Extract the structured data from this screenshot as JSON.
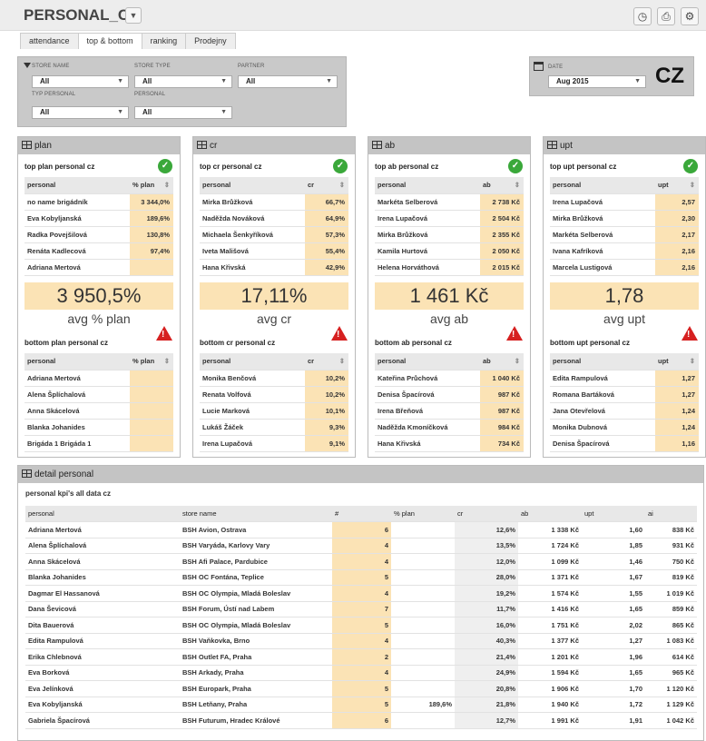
{
  "app": {
    "title": "PERSONAL_CZ",
    "country": "CZ"
  },
  "tabs": [
    {
      "label": "attendance"
    },
    {
      "label": "top & bottom"
    },
    {
      "label": "ranking"
    },
    {
      "label": "Prodejny"
    }
  ],
  "filters": {
    "store_name": {
      "label": "STORE NAME",
      "value": "All"
    },
    "store_type": {
      "label": "STORE TYPE",
      "value": "All"
    },
    "partner": {
      "label": "PARTNER",
      "value": "All"
    },
    "typ_personal": {
      "label": "TYP PERSONAL",
      "value": "All"
    },
    "personal": {
      "label": "PERSONAL",
      "value": "All"
    },
    "date": {
      "label": "DATE",
      "value": "Aug 2015"
    }
  },
  "panels": [
    {
      "title": "plan",
      "top_title": "top plan personal cz",
      "col": "% plan",
      "top": [
        [
          "no name brigádník",
          "3 344,0%"
        ],
        [
          "Eva Kobyljanská",
          "189,6%"
        ],
        [
          "Radka Povejšilová",
          "130,8%"
        ],
        [
          "Renáta Kadlecová",
          "97,4%"
        ],
        [
          "Adriana Mertová",
          ""
        ]
      ],
      "big": "3 950,5%",
      "big_label": "avg % plan",
      "bottom_title": "bottom plan personal cz",
      "bottom": [
        [
          "Adriana Mertová",
          ""
        ],
        [
          "Alena Šplíchalová",
          ""
        ],
        [
          "Anna Skácelová",
          ""
        ],
        [
          "Blanka Johanides",
          ""
        ],
        [
          "Brigáda 1 Brigáda 1",
          ""
        ]
      ]
    },
    {
      "title": "cr",
      "top_title": "top cr personal cz",
      "col": "cr",
      "top": [
        [
          "Mirka Brůžková",
          "66,7%"
        ],
        [
          "Naděžda Nováková",
          "64,9%"
        ],
        [
          "Michaela Šenkyříková",
          "57,3%"
        ],
        [
          "Iveta Mališová",
          "55,4%"
        ],
        [
          "Hana Křivská",
          "42,9%"
        ]
      ],
      "big": "17,11%",
      "big_label": "avg cr",
      "bottom_title": "bottom cr personal cz",
      "bottom": [
        [
          "Monika Benčová",
          "10,2%"
        ],
        [
          "Renata Volfová",
          "10,2%"
        ],
        [
          "Lucie Marková",
          "10,1%"
        ],
        [
          "Lukáš Žáček",
          "9,3%"
        ],
        [
          "Irena Lupačová",
          "9,1%"
        ]
      ]
    },
    {
      "title": "ab",
      "top_title": "top ab personal cz",
      "col": "ab",
      "top": [
        [
          "Markéta Selberová",
          "2 738 Kč"
        ],
        [
          "Irena Lupačová",
          "2 504 Kč"
        ],
        [
          "Mirka Brůžková",
          "2 355 Kč"
        ],
        [
          "Kamila Hurtová",
          "2 050 Kč"
        ],
        [
          "Helena Horváthová",
          "2 015 Kč"
        ]
      ],
      "big": "1 461 Kč",
      "big_label": "avg ab",
      "bottom_title": "bottom ab personal cz",
      "bottom": [
        [
          "Kateřina Průchová",
          "1 040 Kč"
        ],
        [
          "Denisa Špacírová",
          "987 Kč"
        ],
        [
          "Irena Břeňová",
          "987 Kč"
        ],
        [
          "Naděžda Kmoníčková",
          "984 Kč"
        ],
        [
          "Hana Křivská",
          "734 Kč"
        ]
      ]
    },
    {
      "title": "upt",
      "top_title": "top upt personal cz",
      "col": "upt",
      "top": [
        [
          "Irena Lupačová",
          "2,57"
        ],
        [
          "Mirka Brůžková",
          "2,30"
        ],
        [
          "Markéta Selberová",
          "2,17"
        ],
        [
          "Ivana Kafríková",
          "2,16"
        ],
        [
          "Marcela Lustigová",
          "2,16"
        ]
      ],
      "big": "1,78",
      "big_label": "avg upt",
      "bottom_title": "bottom upt personal cz",
      "bottom": [
        [
          "Edita Rampulová",
          "1,27"
        ],
        [
          "Romana Bartáková",
          "1,27"
        ],
        [
          "Jana Otevřelová",
          "1,24"
        ],
        [
          "Monika Dubnová",
          "1,24"
        ],
        [
          "Denisa Špacírová",
          "1,16"
        ]
      ]
    }
  ],
  "personal_header": "personal",
  "detail": {
    "title": "detail personal",
    "subtitle": "personal kpi's all data cz",
    "columns": [
      "personal",
      "store name",
      "#",
      "% plan",
      "cr",
      "ab",
      "upt",
      "ai"
    ],
    "rows": [
      [
        "Adriana Mertová",
        "BSH Avion, Ostrava",
        "6",
        "",
        "12,6%",
        "1 338 Kč",
        "1,60",
        "838 Kč"
      ],
      [
        "Alena Šplíchalová",
        "BSH Varyáda, Karlovy Vary",
        "4",
        "",
        "13,5%",
        "1 724 Kč",
        "1,85",
        "931 Kč"
      ],
      [
        "Anna Skácelová",
        "BSH Afi Palace, Pardubice",
        "4",
        "",
        "12,0%",
        "1 099 Kč",
        "1,46",
        "750 Kč"
      ],
      [
        "Blanka Johanides",
        "BSH OC Fontána, Teplice",
        "5",
        "",
        "28,0%",
        "1 371 Kč",
        "1,67",
        "819 Kč"
      ],
      [
        "Dagmar El Hassanová",
        "BSH OC Olympia, Mladá Boleslav",
        "4",
        "",
        "19,2%",
        "1 574 Kč",
        "1,55",
        "1 019 Kč"
      ],
      [
        "Dana Ševicová",
        "BSH Forum, Ústí nad Labem",
        "7",
        "",
        "11,7%",
        "1 416 Kč",
        "1,65",
        "859 Kč"
      ],
      [
        "Dita Bauerová",
        "BSH OC Olympia, Mladá Boleslav",
        "5",
        "",
        "16,0%",
        "1 751 Kč",
        "2,02",
        "865 Kč"
      ],
      [
        "Edita Rampulová",
        "BSH Vaňkovka, Brno",
        "4",
        "",
        "40,3%",
        "1 377 Kč",
        "1,27",
        "1 083 Kč"
      ],
      [
        "Erika Chlebnová",
        "BSH Outlet FA, Praha",
        "2",
        "",
        "21,4%",
        "1 201 Kč",
        "1,96",
        "614 Kč"
      ],
      [
        "Eva Borková",
        "BSH Arkady, Praha",
        "4",
        "",
        "24,9%",
        "1 594 Kč",
        "1,65",
        "965 Kč"
      ],
      [
        "Eva Jelínková",
        "BSH Europark, Praha",
        "5",
        "",
        "20,8%",
        "1 906 Kč",
        "1,70",
        "1 120 Kč"
      ],
      [
        "Eva Kobyljanská",
        "BSH Letňany, Praha",
        "5",
        "189,6%",
        "21,8%",
        "1 940 Kč",
        "1,72",
        "1 129 Kč"
      ],
      [
        "Gabriela Špacírová",
        "BSH Futurum, Hradec Králové",
        "6",
        "",
        "12,7%",
        "1 991 Kč",
        "1,91",
        "1 042 Kč"
      ]
    ]
  }
}
